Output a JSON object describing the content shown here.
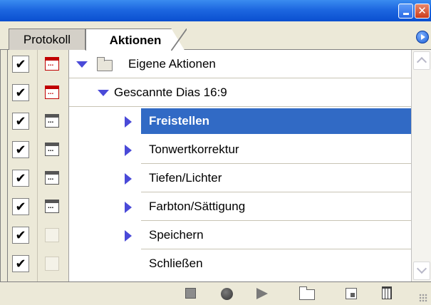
{
  "window": {
    "minimize_icon": "minimize-icon",
    "close_icon": "close-icon",
    "close_glyph": "✕"
  },
  "tabs": [
    {
      "label": "Protokoll",
      "active": false
    },
    {
      "label": "Aktionen",
      "active": true
    }
  ],
  "panel_menu_icon": "panel-menu-icon",
  "actions": {
    "set": {
      "name": "Eigene Aktionen",
      "expanded": true,
      "enabled": "✔",
      "dialog": "red"
    },
    "action": {
      "name": "Gescannte Dias 16:9",
      "expanded": true,
      "enabled": "✔",
      "dialog": "red"
    },
    "steps": [
      {
        "name": "Freistellen",
        "enabled": "✔",
        "dialog": "dark",
        "expandable": true,
        "selected": true
      },
      {
        "name": "Tonwertkorrektur",
        "enabled": "✔",
        "dialog": "dark",
        "expandable": true,
        "selected": false
      },
      {
        "name": "Tiefen/Lichter",
        "enabled": "✔",
        "dialog": "dark",
        "expandable": true,
        "selected": false
      },
      {
        "name": "Farbton/Sättigung",
        "enabled": "✔",
        "dialog": "dark",
        "expandable": true,
        "selected": false
      },
      {
        "name": "Speichern",
        "enabled": "✔",
        "dialog": "none",
        "expandable": true,
        "selected": false
      },
      {
        "name": "Schließen",
        "enabled": "✔",
        "dialog": "none",
        "expandable": false,
        "selected": false
      }
    ]
  },
  "bottom_toolbar": [
    "stop-icon",
    "record-icon",
    "play-icon",
    "new-set-icon",
    "new-action-icon",
    "trash-icon"
  ],
  "colors": {
    "selection": "#316ac5",
    "triangle": "#4a4ad8",
    "dialog_red": "#c00000"
  }
}
